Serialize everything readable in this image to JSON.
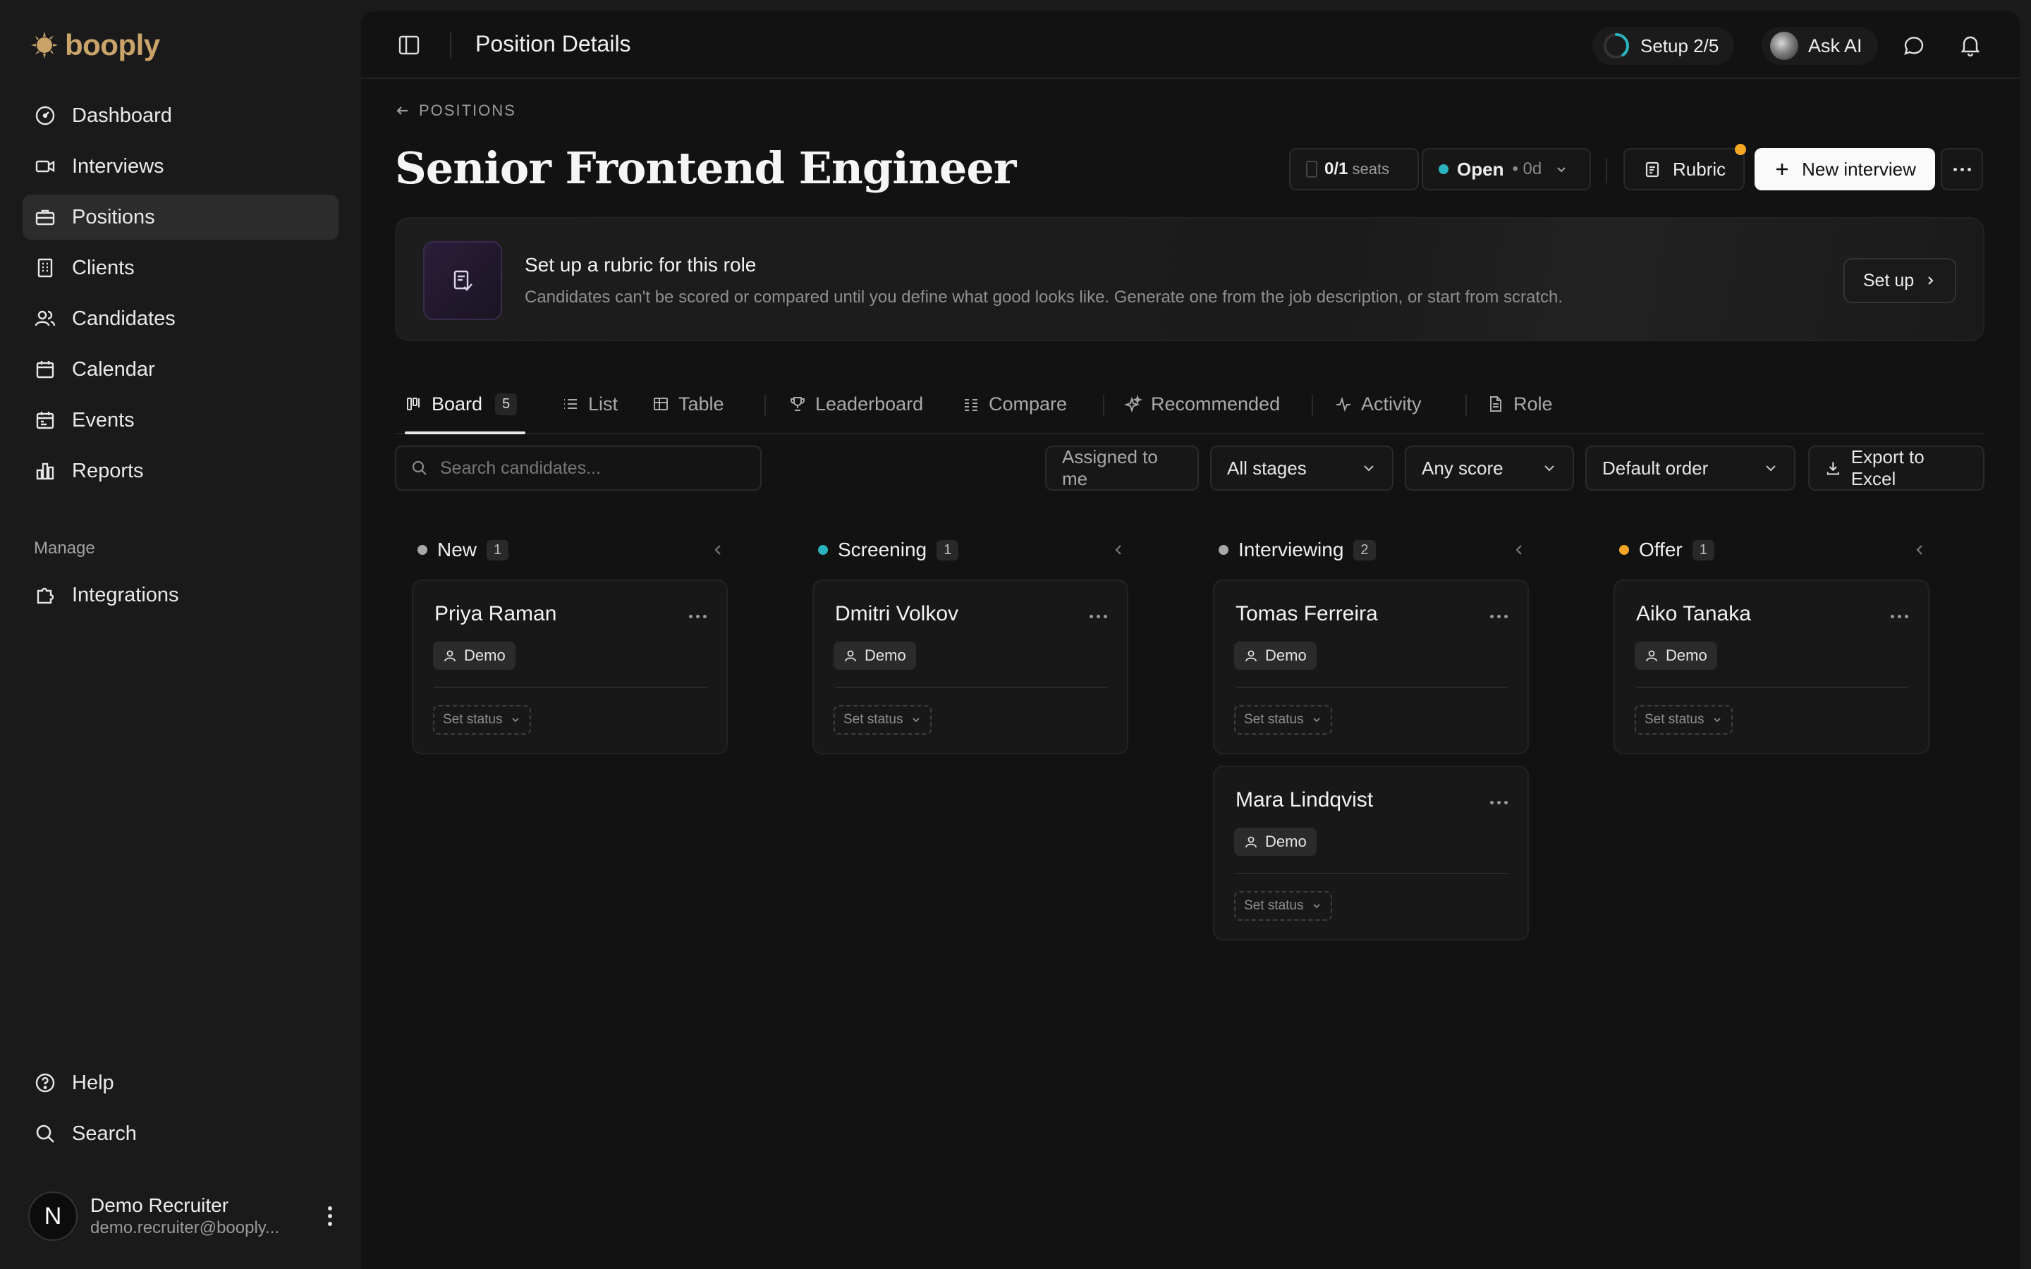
{
  "app": {
    "logo_text": "booply",
    "brand_color": "#c9a36a"
  },
  "sidebar": {
    "items": [
      {
        "label": "Dashboard",
        "icon": "gauge-icon"
      },
      {
        "label": "Interviews",
        "icon": "video-icon"
      },
      {
        "label": "Positions",
        "icon": "briefcase-icon",
        "active": true
      },
      {
        "label": "Clients",
        "icon": "building-icon"
      },
      {
        "label": "Candidates",
        "icon": "users-icon"
      },
      {
        "label": "Calendar",
        "icon": "calendar-icon"
      },
      {
        "label": "Events",
        "icon": "calendar-event-icon"
      },
      {
        "label": "Reports",
        "icon": "bar-chart-icon"
      }
    ],
    "section_label": "Manage",
    "manage_items": [
      {
        "label": "Integrations",
        "icon": "puzzle-icon"
      }
    ],
    "bottom_items": [
      {
        "label": "Help",
        "icon": "help-circle-icon"
      },
      {
        "label": "Search",
        "icon": "search-icon"
      }
    ],
    "user": {
      "initial": "N",
      "name": "Demo Recruiter",
      "email": "demo.recruiter@booply..."
    }
  },
  "topbar": {
    "title": "Position Details",
    "setup": "Setup 2/5",
    "setup_progress": 0.4,
    "ask_ai": "Ask AI"
  },
  "header": {
    "back_label": "POSITIONS",
    "title": "Senior Frontend Engineer",
    "seats_value": "0/1",
    "seats_label": "seats",
    "status": "Open",
    "status_sub": "• 0d",
    "status_color": "#2bb3c0",
    "rubric_label": "Rubric",
    "new_interview_label": "New interview"
  },
  "banner": {
    "title": "Set up a rubric for this role",
    "description": "Candidates can't be scored or compared until you define what good looks like. Generate one from the job description, or start from scratch.",
    "button": "Set up"
  },
  "tabs": [
    {
      "label": "Board",
      "count": "5",
      "active": true
    },
    {
      "label": "List"
    },
    {
      "label": "Table"
    },
    {
      "label": "Leaderboard"
    },
    {
      "label": "Compare"
    },
    {
      "label": "Recommended"
    },
    {
      "label": "Activity"
    },
    {
      "label": "Role"
    }
  ],
  "filters": {
    "search_placeholder": "Search candidates...",
    "assigned": "Assigned to me",
    "stages": "All stages",
    "score": "Any score",
    "order": "Default order",
    "export": "Export to Excel"
  },
  "columns": [
    {
      "title": "New",
      "count": "1",
      "color": "#a8a8a8",
      "cards": [
        {
          "name": "Priya Raman",
          "badge": "Demo",
          "status": "Set status"
        }
      ]
    },
    {
      "title": "Screening",
      "count": "1",
      "color": "#2bb3c0",
      "cards": [
        {
          "name": "Dmitri Volkov",
          "badge": "Demo",
          "status": "Set status"
        }
      ]
    },
    {
      "title": "Interviewing",
      "count": "2",
      "color": "#a8a8a8",
      "cards": [
        {
          "name": "Tomas Ferreira",
          "badge": "Demo",
          "status": "Set status"
        },
        {
          "name": "Mara Lindqvist",
          "badge": "Demo",
          "status": "Set status"
        }
      ]
    },
    {
      "title": "Offer",
      "count": "1",
      "color": "#f5a623",
      "cards": [
        {
          "name": "Aiko Tanaka",
          "badge": "Demo",
          "status": "Set status"
        }
      ]
    }
  ]
}
